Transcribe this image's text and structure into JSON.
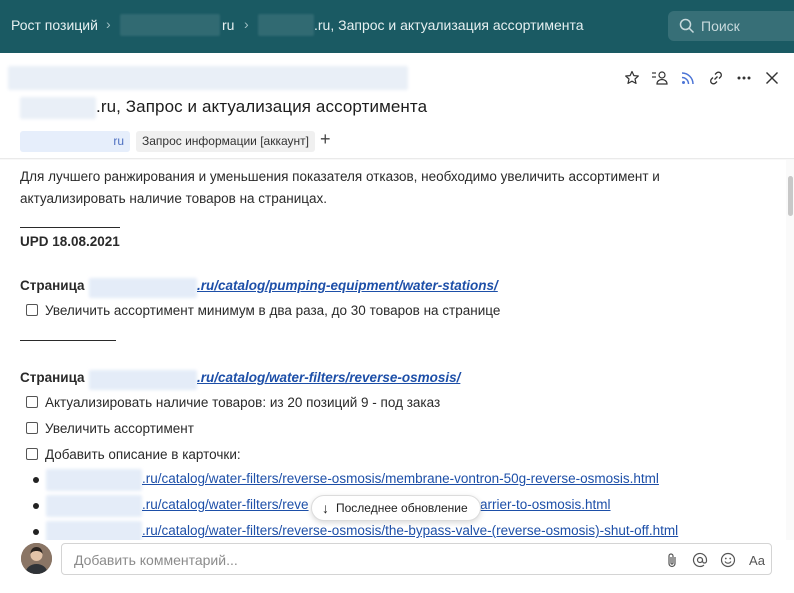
{
  "topbar": {
    "crumb_root": "Рост позиций",
    "crumb_site_suffix": "ru",
    "crumb_task_suffix": ".ru, Запрос и актуализация ассортимента",
    "search_placeholder": "Поиск"
  },
  "task": {
    "title_suffix": ".ru, Запрос и актуализация ассортимента",
    "tag_site_suffix": "ru",
    "tag_type": "Запрос информации [аккаунт]"
  },
  "content": {
    "intro_line1": "Для лучшего ранжирования и уменьшения показателя отказов, необходимо увеличить ассортимент и",
    "intro_line2": "актуализировать наличие товаров на страницах.",
    "upd": "UPD 18.08.2021",
    "page_label": "Страница",
    "section1_url": ".ru/catalog/pumping-equipment/water-stations/",
    "section1_task": "Увеличить ассортимент минимум в два раза, до 30 товаров на странице",
    "section2_url": ".ru/catalog/water-filters/reverse-osmosis/",
    "section2_task1": "Актуализировать наличие товаров: из 20 позиций 9 - под заказ",
    "section2_task2": "Увеличить ассортимент",
    "section2_task3": "Добавить описание в карточки:",
    "links": [
      ".ru/catalog/water-filters/reverse-osmosis/membrane-vontron-50g-reverse-osmosis.html",
      ".ru/catalog/water-filters/reve",
      "arrier-to-osmosis.html",
      ".ru/catalog/water-filters/reverse-osmosis/the-bypass-valve-(reverse-osmosis)-shut-off.html"
    ]
  },
  "floating": {
    "latest_update": "Последнее обновление"
  },
  "comment": {
    "placeholder": "Добавить комментарий...",
    "format_label": "Aa"
  },
  "colors": {
    "topbar": "#1a5a63",
    "link": "#1d4fa8"
  }
}
